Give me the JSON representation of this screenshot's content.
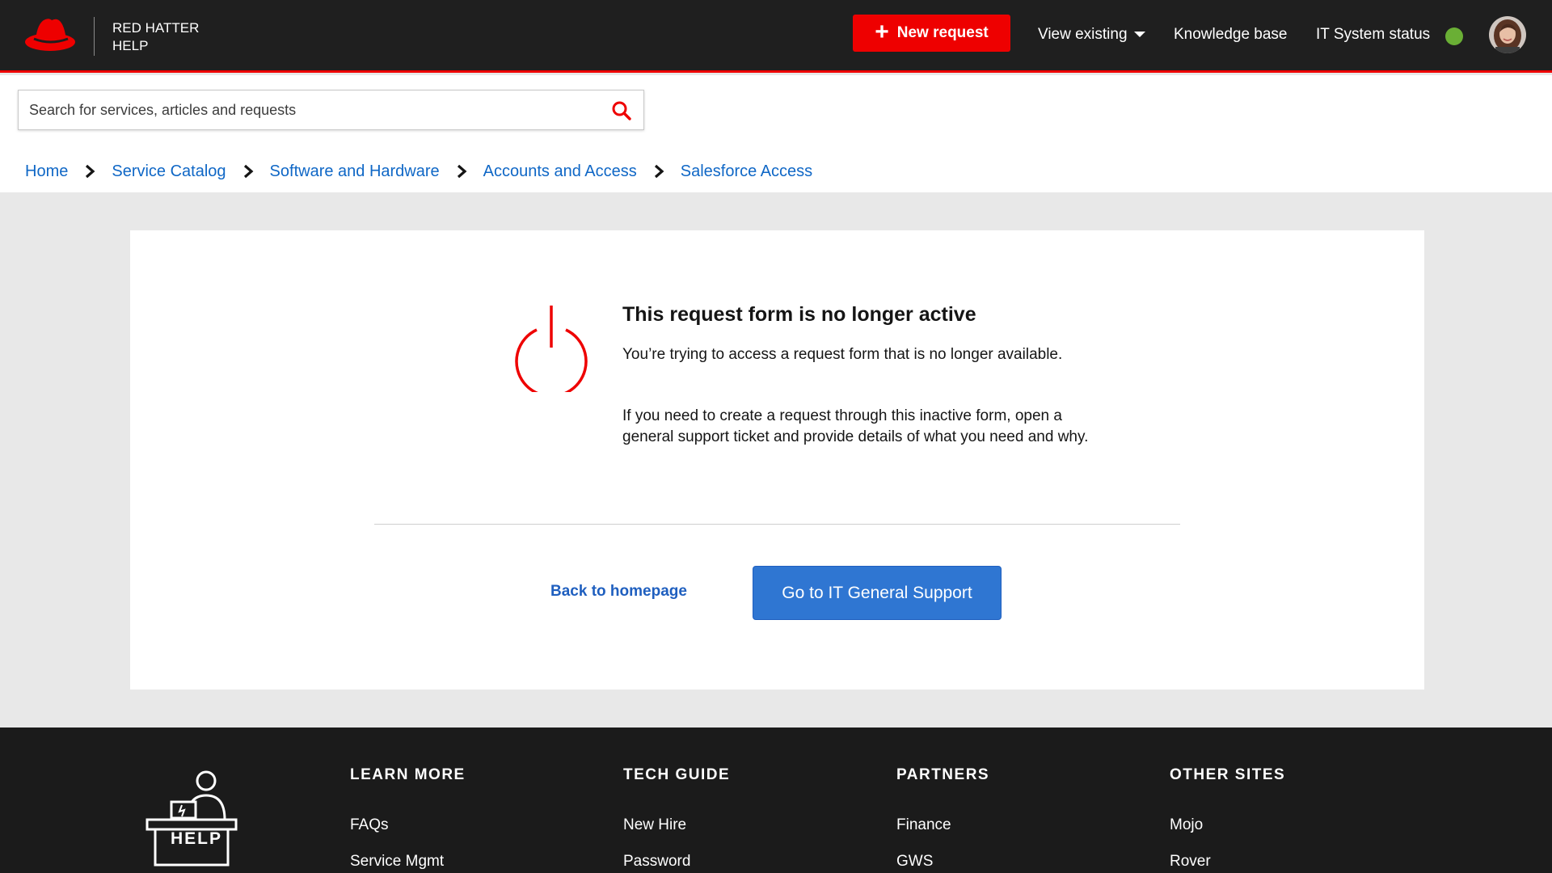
{
  "brand": {
    "line1": "RED HATTER",
    "line2": "HELP"
  },
  "header": {
    "new_request": "New request",
    "view_existing": "View existing",
    "knowledge_base": "Knowledge base",
    "it_status": "IT System status",
    "status_color": "#6aaf35",
    "accent_color": "#ee0000"
  },
  "search": {
    "placeholder": "Search for services, articles and requests",
    "icon": "search-icon"
  },
  "breadcrumb": [
    "Home",
    "Service Catalog",
    "Software and Hardware",
    "Accounts and Access",
    "Salesforce Access"
  ],
  "message": {
    "icon": "power-icon",
    "title": "This request form is no longer active",
    "para1": "You’re trying to access a request form that is no longer available.",
    "para2": "If you need to create a request through this inactive form, open a general support ticket and provide details of what you need and why.",
    "back_link": "Back to homepage",
    "primary_button": "Go to IT General Support",
    "button_color": "#2f76d2"
  },
  "footer": {
    "help_label": "HELP",
    "columns": [
      {
        "heading": "LEARN MORE",
        "links": [
          "FAQs",
          "Service Mgmt"
        ]
      },
      {
        "heading": "TECH GUIDE",
        "links": [
          "New Hire",
          "Password"
        ]
      },
      {
        "heading": "PARTNERS",
        "links": [
          "Finance",
          "GWS"
        ]
      },
      {
        "heading": "OTHER SITES",
        "links": [
          "Mojo",
          "Rover"
        ]
      }
    ]
  }
}
